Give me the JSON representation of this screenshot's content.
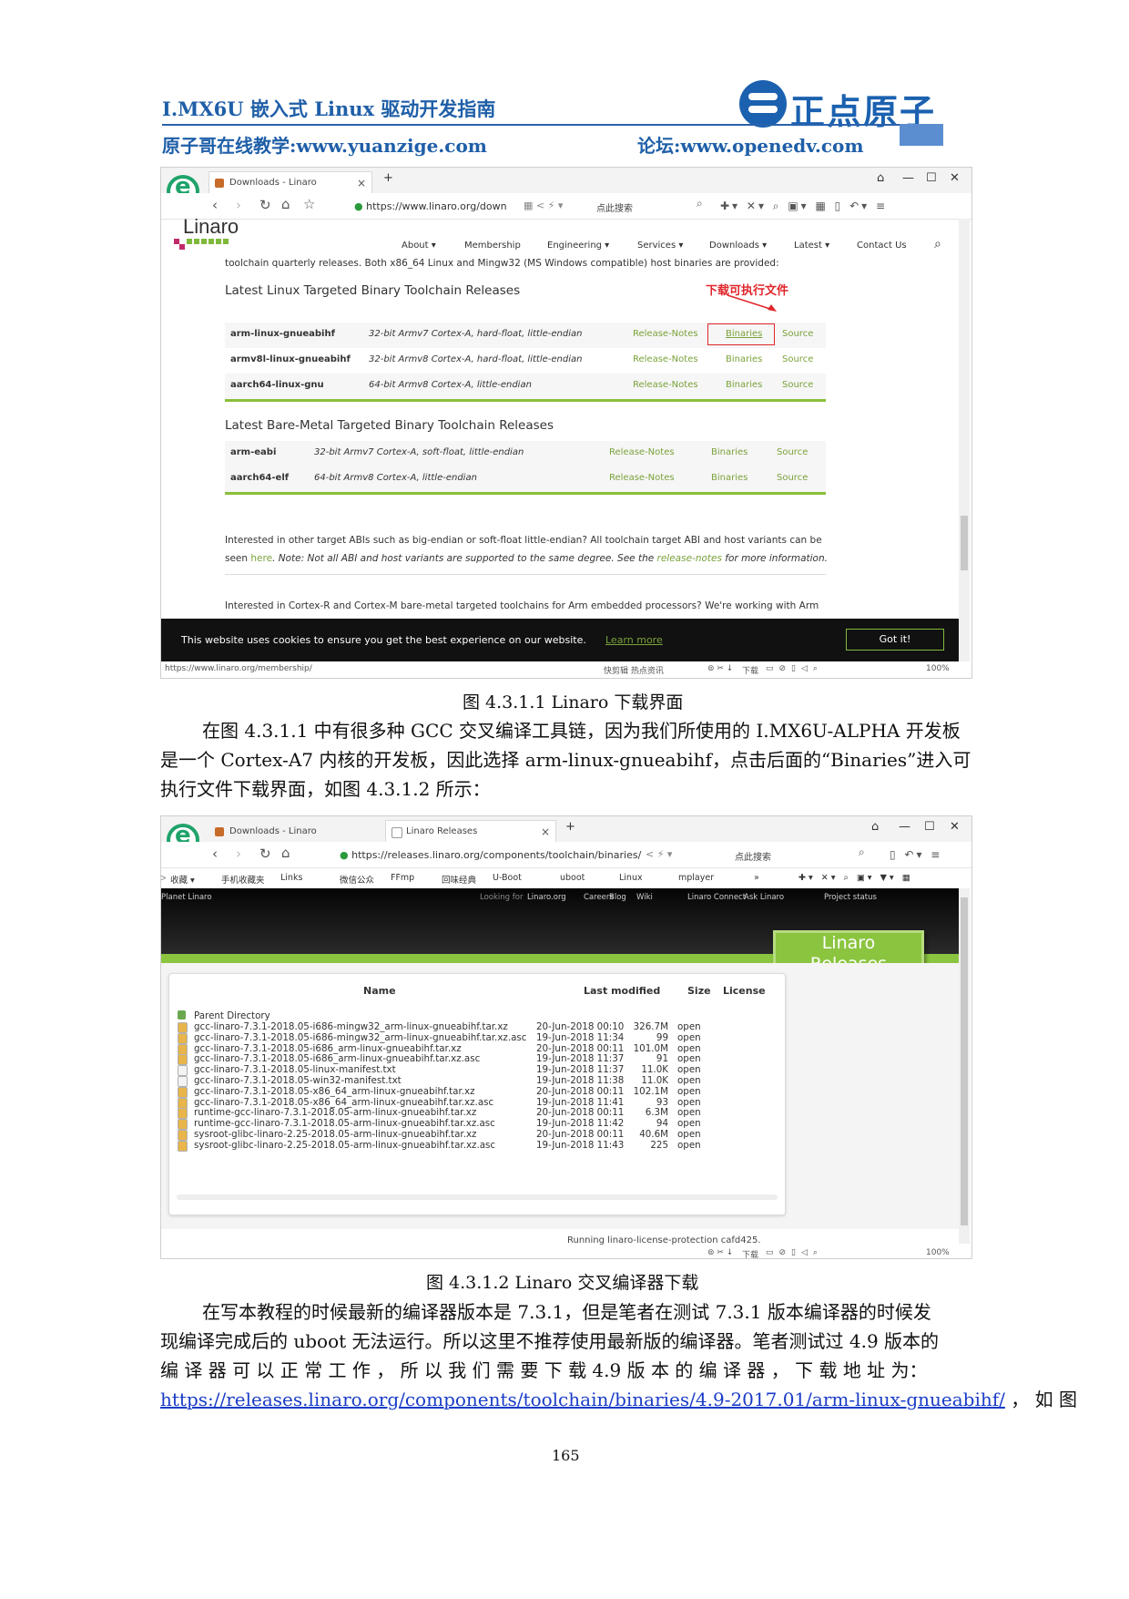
{
  "header": {
    "title": "I.MX6U 嵌入式 Linux 驱动开发指南",
    "left_sub": "原子哥在线教学:www.yuanzige.com",
    "right_sub": "论坛:www.openedv.com",
    "logo_text": "正点原子"
  },
  "shot1": {
    "tab_label": "Downloads - Linaro",
    "url": "https://www.linaro.org/down",
    "search_placeholder": "点此搜索",
    "site_logo": "Linaro",
    "nav": [
      "About ▾",
      "Membership",
      "Engineering ▾",
      "Services ▾",
      "Downloads ▾",
      "Latest ▾",
      "Contact Us"
    ],
    "intro_line": "toolchain quarterly releases. Both x86_64 Linux and Mingw32 (MS Windows compatible) host binaries are provided:",
    "annotation": "下载可执行文件",
    "linux_title": "Latest Linux Targeted Binary Toolchain Releases",
    "linux_rows": [
      {
        "name": "arm-linux-gnueabihf",
        "desc": "32-bit Armv7 Cortex-A, hard-float, little-endian",
        "notes": "Release-Notes",
        "bin": "Binaries",
        "src": "Source"
      },
      {
        "name": "armv8l-linux-gnueabihf",
        "desc": "32-bit Armv8 Cortex-A, hard-float, little-endian",
        "notes": "Release-Notes",
        "bin": "Binaries",
        "src": "Source"
      },
      {
        "name": "aarch64-linux-gnu",
        "desc": "64-bit Armv8 Cortex-A, little-endian",
        "notes": "Release-Notes",
        "bin": "Binaries",
        "src": "Source"
      }
    ],
    "bare_title": "Latest Bare-Metal Targeted Binary Toolchain Releases",
    "bare_rows": [
      {
        "name": "arm-eabi",
        "desc": "32-bit Armv7 Cortex-A, soft-float, little-endian",
        "notes": "Release-Notes",
        "bin": "Binaries",
        "src": "Source"
      },
      {
        "name": "aarch64-elf",
        "desc": "64-bit Armv8 Cortex-A, little-endian",
        "notes": "Release-Notes",
        "bin": "Binaries",
        "src": "Source"
      }
    ],
    "para1_a": "Interested in other target ABIs such as big-endian or soft-float little-endian? All toolchain target ABI and host variants can be",
    "para1_b1": "seen ",
    "para1_here": "here",
    "para1_b2": ". Note: Not all ABI and host variants are supported to the same degree. See the ",
    "para1_rn": "release-notes",
    "para1_b3": " for more information.",
    "para2": "Interested in Cortex-R and Cortex-M bare-metal targeted toolchains for Arm embedded processors? We're working with Arm",
    "cookie_text": "This website uses cookies to ensure you get the best experience on our website.",
    "cookie_link": "Learn more",
    "cookie_btn": "Got it!",
    "status_url": "https://www.linaro.org/membership/",
    "status_items": "快剪辑   热点资讯",
    "status_dl": "下载",
    "zoom": "100%"
  },
  "caption1": "图 4.3.1.1 Linaro 下载界面",
  "body1": [
    "在图 4.3.1.1 中有很多种 GCC 交叉编译工具链，因为我们所使用的 I.MX6U-ALPHA 开发板",
    "是一个 Cortex-A7 内核的开发板，因此选择 arm-linux-gnueabihf，点击后面的“Binaries”进入可",
    "执行文件下载界面，如图 4.3.1.2 所示："
  ],
  "shot2": {
    "tab1": "Downloads - Linaro",
    "tab2": "Linaro Releases",
    "url": "https://releases.linaro.org/components/toolchain/binaries/",
    "search_placeholder": "点此搜索",
    "bookmarks": [
      "收藏 ▾",
      "手机收藏夹",
      "Links",
      "微信公众",
      "FFmp",
      "回味经典",
      "U-Boot",
      "uboot",
      "Linux",
      "mplayer",
      "»"
    ],
    "top_links": [
      "Looking for",
      "Linaro.org",
      "Careers",
      "Blog",
      "Wiki",
      "Linaro Connect",
      "Ask Linaro",
      "Project status",
      "Planet Linaro"
    ],
    "badge_l1": "Linaro",
    "badge_l2": "Releases",
    "col_name": "Name",
    "col_modified": "Last modified",
    "col_size": "Size",
    "col_license": "License",
    "parent": "Parent Directory",
    "files": [
      {
        "name": "gcc-linaro-7.3.1-2018.05-i686-mingw32_arm-linux-gnueabihf.tar.xz",
        "date": "20-Jun-2018 00:10",
        "size": "326.7M",
        "lic": "open"
      },
      {
        "name": "gcc-linaro-7.3.1-2018.05-i686-mingw32_arm-linux-gnueabihf.tar.xz.asc",
        "date": "19-Jun-2018 11:34",
        "size": "99",
        "lic": "open"
      },
      {
        "name": "gcc-linaro-7.3.1-2018.05-i686_arm-linux-gnueabihf.tar.xz",
        "date": "20-Jun-2018 00:11",
        "size": "101.0M",
        "lic": "open"
      },
      {
        "name": "gcc-linaro-7.3.1-2018.05-i686_arm-linux-gnueabihf.tar.xz.asc",
        "date": "19-Jun-2018 11:37",
        "size": "91",
        "lic": "open"
      },
      {
        "name": "gcc-linaro-7.3.1-2018.05-linux-manifest.txt",
        "date": "19-Jun-2018 11:37",
        "size": "11.0K",
        "lic": "open"
      },
      {
        "name": "gcc-linaro-7.3.1-2018.05-win32-manifest.txt",
        "date": "19-Jun-2018 11:38",
        "size": "11.0K",
        "lic": "open"
      },
      {
        "name": "gcc-linaro-7.3.1-2018.05-x86_64_arm-linux-gnueabihf.tar.xz",
        "date": "20-Jun-2018 00:11",
        "size": "102.1M",
        "lic": "open"
      },
      {
        "name": "gcc-linaro-7.3.1-2018.05-x86_64_arm-linux-gnueabihf.tar.xz.asc",
        "date": "19-Jun-2018 11:41",
        "size": "93",
        "lic": "open"
      },
      {
        "name": "runtime-gcc-linaro-7.3.1-2018.05-arm-linux-gnueabihf.tar.xz",
        "date": "20-Jun-2018 00:11",
        "size": "6.3M",
        "lic": "open"
      },
      {
        "name": "runtime-gcc-linaro-7.3.1-2018.05-arm-linux-gnueabihf.tar.xz.asc",
        "date": "19-Jun-2018 11:42",
        "size": "94",
        "lic": "open"
      },
      {
        "name": "sysroot-glibc-linaro-2.25-2018.05-arm-linux-gnueabihf.tar.xz",
        "date": "20-Jun-2018 00:11",
        "size": "40.6M",
        "lic": "open"
      },
      {
        "name": "sysroot-glibc-linaro-2.25-2018.05-arm-linux-gnueabihf.tar.xz.asc",
        "date": "19-Jun-2018 11:43",
        "size": "225",
        "lic": "open"
      }
    ],
    "running": "Running linaro-license-protection cafd425.",
    "status_dl": "下载",
    "zoom": "100%"
  },
  "caption2": "图 4.3.1.2 Linaro 交叉编译器下载",
  "body2": [
    "在写本教程的时候最新的编译器版本是 7.3.1，但是笔者在测试 7.3.1 版本编译器的时候发",
    "现编译完成后的 uboot 无法运行。所以这里不推荐使用最新版的编译器。笔者测试过 4.9 版本的",
    "编 译 器 可 以 正 常 工 作 ， 所 以 我 们 需 要 下 载   4.9   版 本 的 编 译 器 ， 下 载 地 址 为："
  ],
  "body2_link": "https://releases.linaro.org/components/toolchain/binaries/4.9-2017.01/arm-linux-gnueabihf/",
  "body2_tail": "，  如 图",
  "page_number": "165"
}
